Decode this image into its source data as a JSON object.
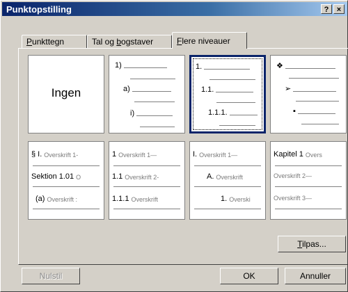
{
  "window": {
    "title": "Punktopstilling",
    "help_btn": "?",
    "close_btn": "×"
  },
  "tabs": [
    {
      "label_pre": "",
      "label_u": "P",
      "label_post": "unkttegn",
      "active": false
    },
    {
      "label_pre": "Tal og ",
      "label_u": "b",
      "label_post": "ogstaver",
      "active": false
    },
    {
      "label_pre": "",
      "label_u": "F",
      "label_post": "lere niveauer",
      "active": true
    }
  ],
  "gallery": {
    "none_label": "Ingen",
    "row1": {
      "c2": [
        "1)",
        "a)",
        "i)"
      ],
      "c3": [
        "1.",
        "1.1.",
        "1.1.1."
      ],
      "c4": [
        "❖",
        "➢",
        "▪"
      ]
    },
    "row2": {
      "c1": [
        {
          "mark": "§ I.",
          "text": "Overskrift 1-"
        },
        {
          "mark": "Sektion 1.01",
          "text": "O"
        },
        {
          "mark": "(a)",
          "text": "Overskrift :"
        }
      ],
      "c2": [
        {
          "mark": "1",
          "text": "Overskrift 1—"
        },
        {
          "mark": "1.1",
          "text": "Overskrift 2-"
        },
        {
          "mark": "1.1.1",
          "text": "Overskrift"
        }
      ],
      "c3": [
        {
          "mark": "I.",
          "text": "Overskrift 1—"
        },
        {
          "mark": "A.",
          "text": "Overskrift"
        },
        {
          "mark": "1.",
          "text": "Overski"
        }
      ],
      "c4": [
        {
          "mark": "Kapitel 1",
          "text": "Overs"
        },
        {
          "mark": "",
          "text": "Overskrift 2—"
        },
        {
          "mark": "",
          "text": "Overskrift 3—"
        }
      ]
    }
  },
  "buttons": {
    "customize_u": "T",
    "customize_rest": "ilpas...",
    "reset": "Nulstil",
    "ok": "OK",
    "cancel": "Annuller"
  }
}
